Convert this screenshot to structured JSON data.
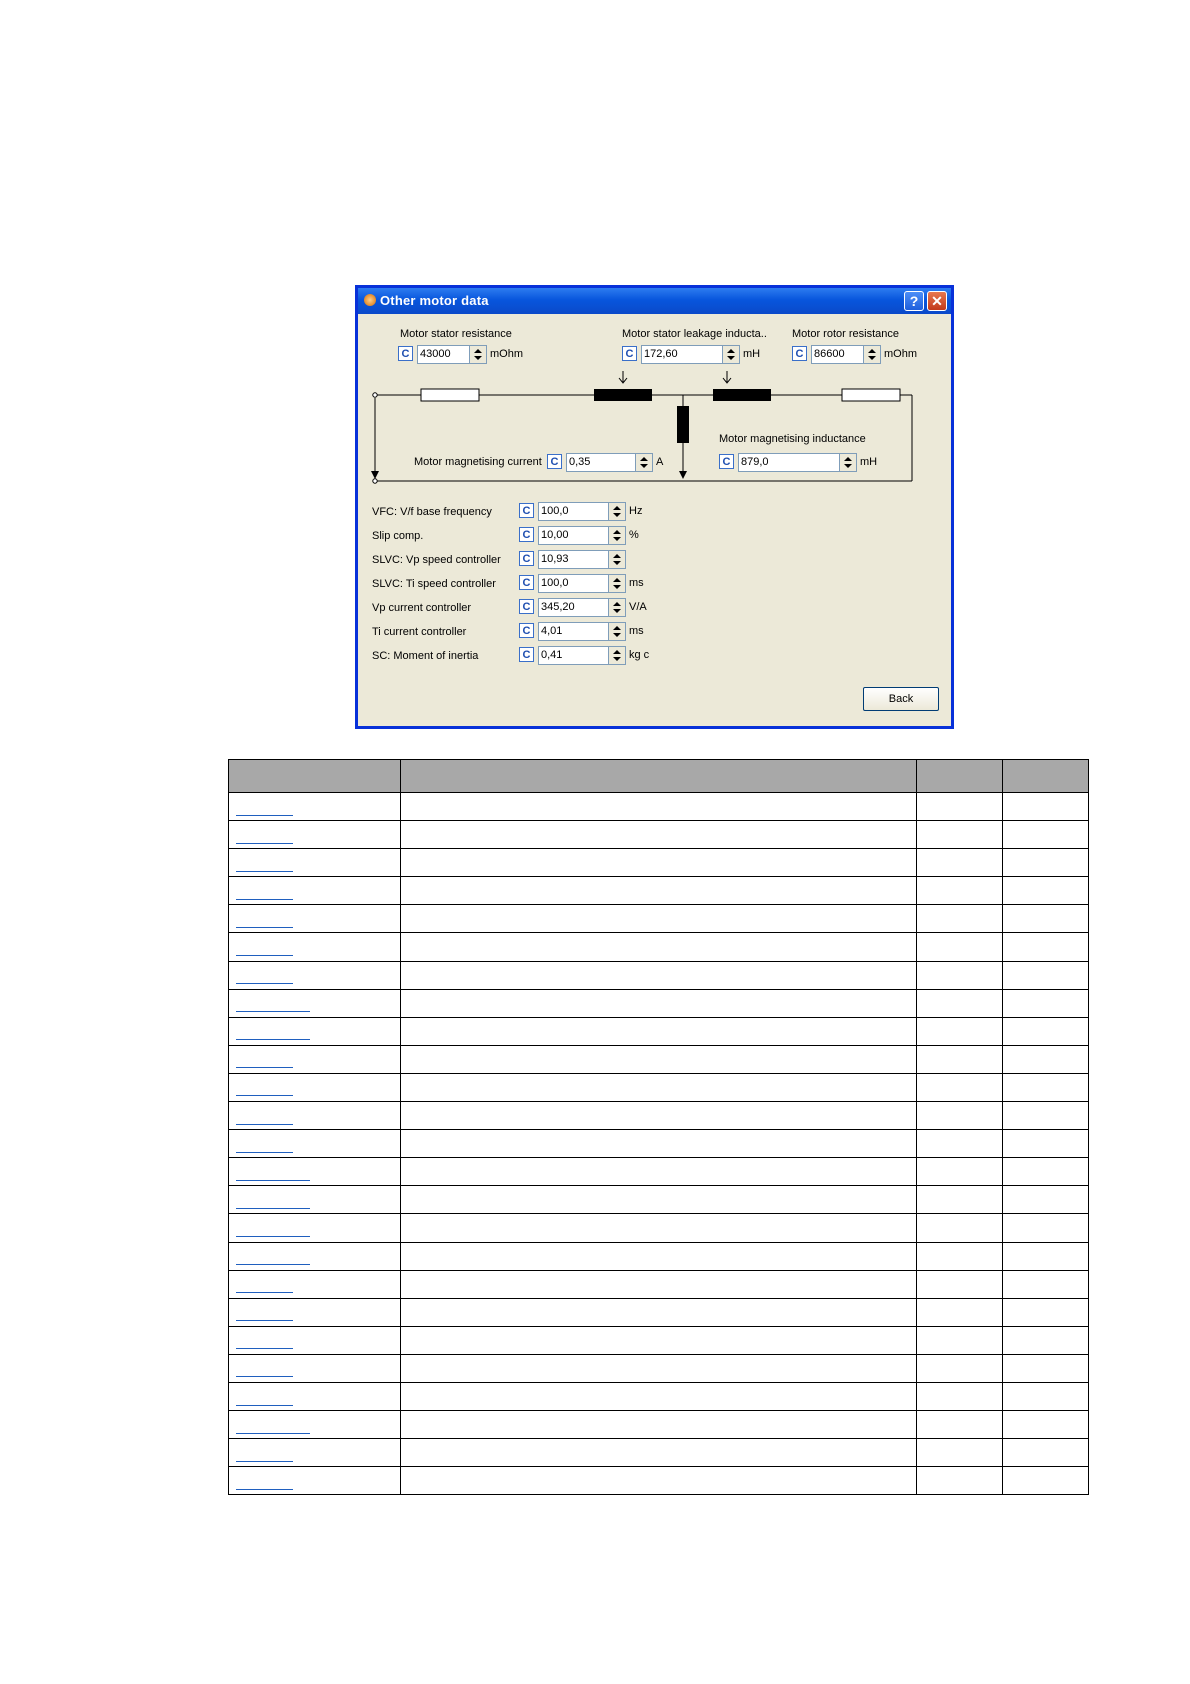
{
  "dialog": {
    "title": "Other motor data",
    "help_glyph": "?",
    "close_glyph": "✕",
    "icons": {
      "app": "app-icon",
      "help": "help-icon",
      "close": "close-icon",
      "down_arrow": "down-arrow-icon"
    },
    "c_label": "C",
    "stator_resistance": {
      "label": "Motor stator resistance",
      "value": "43000",
      "unit": "mOhm"
    },
    "stator_leakage": {
      "label": "Motor stator leakage inducta..",
      "value": "172,60",
      "unit": "mH"
    },
    "rotor_resistance": {
      "label": "Motor rotor resistance",
      "value": "86600",
      "unit": "mOhm"
    },
    "magnetising_current": {
      "label": "Motor magnetising current",
      "value": "0,35",
      "unit": "A"
    },
    "magnetising_inductance": {
      "label": "Motor magnetising inductance",
      "value": "879,0",
      "unit": "mH"
    },
    "params": [
      {
        "label": "VFC: V/f base frequency",
        "value": "100,0",
        "unit": "Hz"
      },
      {
        "label": "Slip comp.",
        "value": "10,00",
        "unit": "%"
      },
      {
        "label": "SLVC: Vp speed controller",
        "value": "10,93",
        "unit": ""
      },
      {
        "label": "SLVC: Ti speed controller",
        "value": "100,0",
        "unit": "ms"
      },
      {
        "label": "Vp current controller",
        "value": "345,20",
        "unit": "V/A"
      },
      {
        "label": "Ti current controller",
        "value": "4,01",
        "unit": "ms"
      },
      {
        "label": "SC: Moment of inertia",
        "value": "0,41",
        "unit": "kg c"
      }
    ],
    "back_label": "Back"
  },
  "table": {
    "link_kinds": [
      "short",
      "short",
      "short",
      "short",
      "short",
      "short",
      "short",
      "long",
      "long",
      "short",
      "short",
      "short",
      "short",
      "long",
      "long",
      "long",
      "long",
      "short",
      "short",
      "short",
      "short",
      "short",
      "long",
      "short",
      "short"
    ]
  }
}
